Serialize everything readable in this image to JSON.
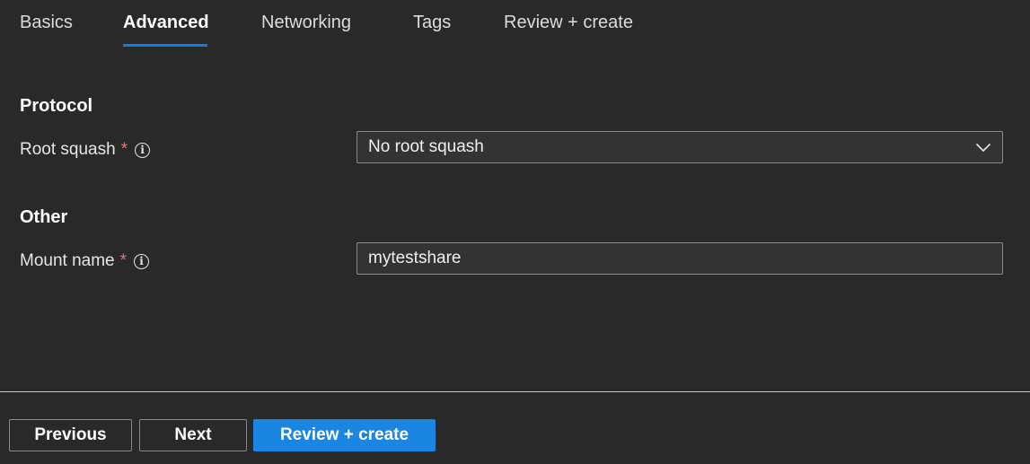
{
  "tabs": [
    {
      "label": "Basics",
      "active": false
    },
    {
      "label": "Advanced",
      "active": true
    },
    {
      "label": "Networking",
      "active": false
    },
    {
      "label": "Tags",
      "active": false
    },
    {
      "label": "Review + create",
      "active": false
    }
  ],
  "protocol": {
    "title": "Protocol",
    "root_squash": {
      "label": "Root squash",
      "required_mark": "*",
      "info_glyph": "i",
      "selected_value": "No root squash"
    }
  },
  "other": {
    "title": "Other",
    "mount_name": {
      "label": "Mount name",
      "required_mark": "*",
      "info_glyph": "i",
      "value": "mytestshare"
    }
  },
  "footer": {
    "previous_label": "Previous",
    "next_label": "Next",
    "review_label": "Review + create"
  },
  "colors": {
    "background": "#292929",
    "accent": "#1a86e2",
    "tab_underline": "#0f7ee0",
    "required": "#f1707b"
  },
  "icons": {
    "info": "info-circle-icon",
    "dropdown": "chevron-down-icon"
  }
}
